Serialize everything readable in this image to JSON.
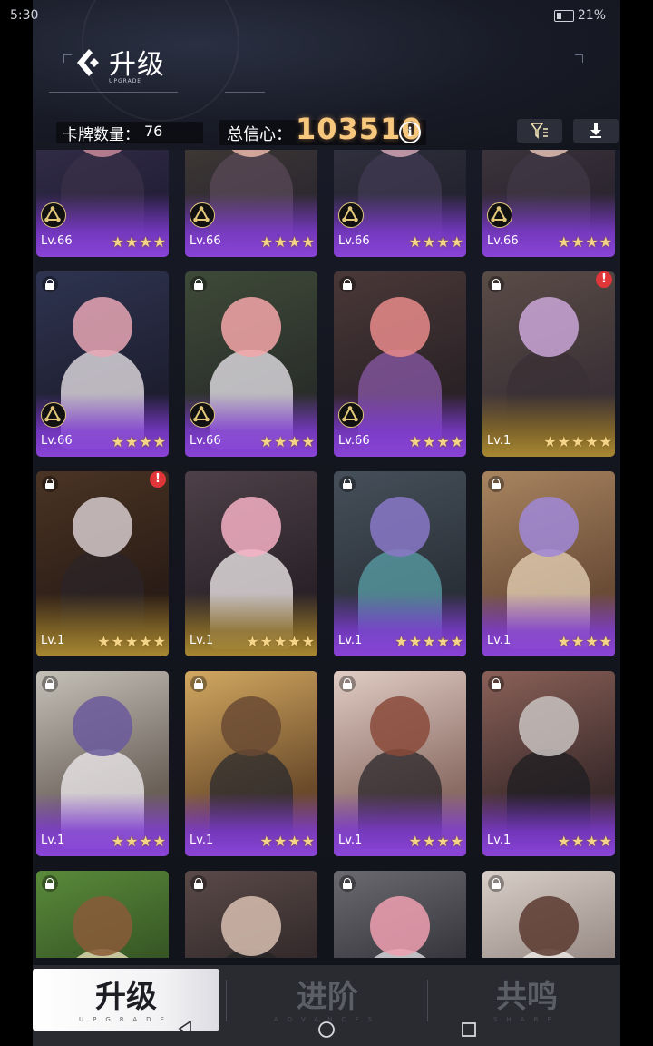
{
  "status_bar": {
    "time": "5:30",
    "battery": "21%"
  },
  "header": {
    "title": "升级",
    "title_sub": "UPGRADE"
  },
  "stats": {
    "card_count_label": "卡牌数量：",
    "card_count": "76",
    "trust_label": "总信心：",
    "trust_value": "103510"
  },
  "colors": {
    "accent_gold": "#f7c77d",
    "rarity_purple": "#8a44d8",
    "rarity_gold": "#a88832",
    "alert_red": "#e0363a"
  },
  "cards": [
    {
      "level": "Lv.66",
      "stars": 4,
      "rarity": "purple",
      "locked": false,
      "badge": true,
      "alert": false
    },
    {
      "level": "Lv.66",
      "stars": 4,
      "rarity": "purple",
      "locked": false,
      "badge": true,
      "alert": false
    },
    {
      "level": "Lv.66",
      "stars": 4,
      "rarity": "purple",
      "locked": false,
      "badge": true,
      "alert": false
    },
    {
      "level": "Lv.66",
      "stars": 4,
      "rarity": "purple",
      "locked": false,
      "badge": true,
      "alert": false
    },
    {
      "level": "Lv.66",
      "stars": 4,
      "rarity": "purple",
      "locked": true,
      "badge": true,
      "alert": false
    },
    {
      "level": "Lv.66",
      "stars": 4,
      "rarity": "purple",
      "locked": true,
      "badge": true,
      "alert": false
    },
    {
      "level": "Lv.66",
      "stars": 4,
      "rarity": "purple",
      "locked": true,
      "badge": true,
      "alert": false
    },
    {
      "level": "Lv.1",
      "stars": 5,
      "rarity": "gold",
      "locked": true,
      "badge": false,
      "alert": true
    },
    {
      "level": "Lv.1",
      "stars": 5,
      "rarity": "gold",
      "locked": true,
      "badge": false,
      "alert": true
    },
    {
      "level": "Lv.1",
      "stars": 5,
      "rarity": "gold",
      "locked": false,
      "badge": false,
      "alert": false
    },
    {
      "level": "Lv.1",
      "stars": 5,
      "rarity": "purple",
      "locked": true,
      "badge": false,
      "alert": false
    },
    {
      "level": "Lv.1",
      "stars": 4,
      "rarity": "purple",
      "locked": true,
      "badge": false,
      "alert": false
    },
    {
      "level": "Lv.1",
      "stars": 4,
      "rarity": "purple",
      "locked": true,
      "badge": false,
      "alert": false
    },
    {
      "level": "Lv.1",
      "stars": 4,
      "rarity": "purple",
      "locked": true,
      "badge": false,
      "alert": false
    },
    {
      "level": "Lv.1",
      "stars": 4,
      "rarity": "purple",
      "locked": true,
      "badge": false,
      "alert": false
    },
    {
      "level": "Lv.1",
      "stars": 4,
      "rarity": "purple",
      "locked": true,
      "badge": false,
      "alert": false
    },
    {
      "level": "",
      "stars": 0,
      "rarity": "none",
      "locked": true,
      "badge": false,
      "alert": false
    },
    {
      "level": "",
      "stars": 0,
      "rarity": "none",
      "locked": true,
      "badge": false,
      "alert": false
    },
    {
      "level": "",
      "stars": 0,
      "rarity": "none",
      "locked": true,
      "badge": false,
      "alert": false
    },
    {
      "level": "",
      "stars": 0,
      "rarity": "none",
      "locked": true,
      "badge": false,
      "alert": false
    }
  ],
  "tabs": [
    {
      "label": "升级",
      "sub": "UPGRADE",
      "active": true
    },
    {
      "label": "进阶",
      "sub": "ADVANCES",
      "active": false
    },
    {
      "label": "共鸣",
      "sub": "SHARE",
      "active": false
    }
  ],
  "icons": {
    "back": "back-chevron-icon",
    "filter": "filter-icon",
    "download": "download-icon",
    "info": "info-icon",
    "lock": "lock-icon",
    "alert": "alert-icon",
    "badge": "bond-badge-icon"
  }
}
